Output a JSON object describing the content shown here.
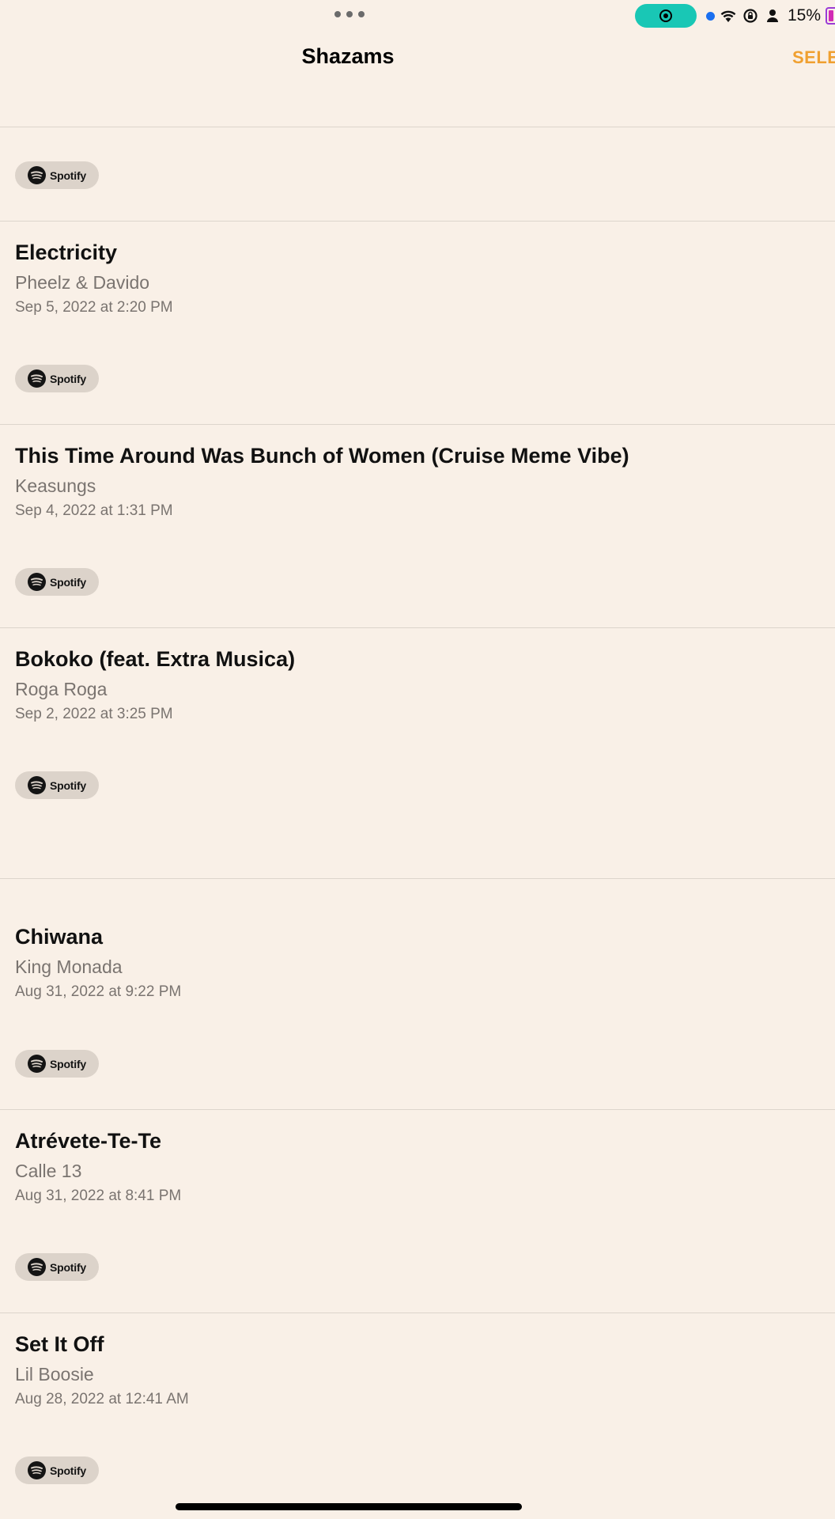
{
  "status_bar": {
    "battery_percent": "15%",
    "record_pill_color": "#19c7b5",
    "icons": [
      "record-icon",
      "location-dot-icon",
      "wifi-icon",
      "rotation-lock-icon",
      "person-icon",
      "battery-icon"
    ]
  },
  "nav": {
    "title": "Shazams",
    "select_label": "SELE",
    "accent_color": "#f0a030"
  },
  "spotify_label": "Spotify",
  "songs": [
    {
      "title": "Electricity",
      "artist": "Pheelz & Davido",
      "date": "Sep 5, 2022 at 2:20 PM"
    },
    {
      "title": "This Time Around Was Bunch of Women (Cruise Meme Vibe)",
      "artist": "Keasungs",
      "date": "Sep 4, 2022 at 1:31 PM"
    },
    {
      "title": "Bokoko (feat. Extra Musica)",
      "artist": "Roga Roga",
      "date": "Sep 2, 2022 at 3:25 PM"
    },
    {
      "title": "Chiwana",
      "artist": "King Monada",
      "date": "Aug 31, 2022 at 9:22 PM"
    },
    {
      "title": "Atrévete-Te-Te",
      "artist": "Calle 13",
      "date": "Aug 31, 2022 at 8:41 PM"
    },
    {
      "title": "Set It Off",
      "artist": "Lil Boosie",
      "date": "Aug 28, 2022 at 12:41 AM"
    }
  ]
}
